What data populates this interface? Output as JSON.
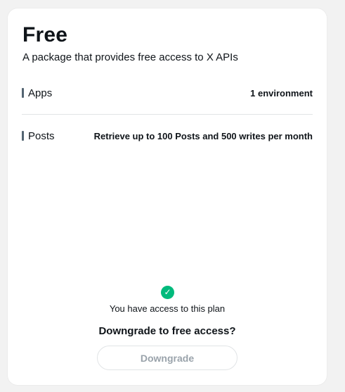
{
  "plan": {
    "title": "Free",
    "subtitle": "A package that provides free access to X APIs"
  },
  "features": [
    {
      "label": "Apps",
      "value": "1 environment"
    },
    {
      "label": "Posts",
      "value": "Retrieve up to 100 Posts and 500 writes per month"
    }
  ],
  "status": {
    "icon": "check-circle-icon",
    "icon_glyph": "✓",
    "color": "#00ba7c",
    "text": "You have access to this plan"
  },
  "downgrade": {
    "heading": "Downgrade to free access?",
    "button_label": "Downgrade"
  }
}
